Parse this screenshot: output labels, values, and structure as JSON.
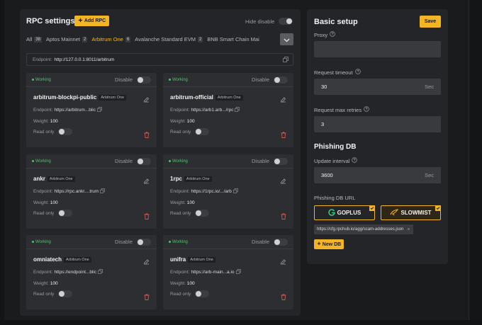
{
  "rpc": {
    "title": "RPC settings",
    "add_label": "Add RPC",
    "hide_disable_label": "Hide disable",
    "endpoint_label": "Endpoint:",
    "endpoint_value": "http://127.0.0.1:8011/arbitrum",
    "tabs": [
      {
        "label": "All",
        "count": "38"
      },
      {
        "label": "Aptos Mainnet",
        "count": "2"
      },
      {
        "label": "Arbitrum One",
        "count": "6"
      },
      {
        "label": "Avalanche Standard EVM",
        "count": "2"
      },
      {
        "label": "BNB Smart Chain Mai",
        "count": ""
      }
    ],
    "active_tab": "Arbitrum One",
    "status_label": "Working",
    "disable_label": "Disable",
    "endpoint_field_label": "Endpoint:",
    "weight_label": "Weight:",
    "readonly_label": "Read only",
    "cards": [
      {
        "name": "arbitrum-blockpi-public",
        "chain": "Arbitrum One",
        "endpoint": "https://arbitrum...blic",
        "weight": "100"
      },
      {
        "name": "arbitrum-official",
        "chain": "Arbitrum One",
        "endpoint": "https://arb1.arb.../rpc",
        "weight": "100"
      },
      {
        "name": "ankr",
        "chain": "Arbitrum One",
        "endpoint": "https://rpc.ankr....trum",
        "weight": "100"
      },
      {
        "name": "1rpc",
        "chain": "Arbitrum One",
        "endpoint": "https://1rpc.io/.../arb",
        "weight": "100"
      },
      {
        "name": "omniatech",
        "chain": "Arbitrum One",
        "endpoint": "https://endpoint...blic",
        "weight": "100"
      },
      {
        "name": "unifra",
        "chain": "Arbitrum One",
        "endpoint": "https://arb-main...a.io",
        "weight": "100"
      }
    ]
  },
  "basic": {
    "title": "Basic setup",
    "save_label": "Save",
    "proxy_label": "Proxy",
    "proxy_value": "",
    "timeout_label": "Request timeout",
    "timeout_value": "30",
    "timeout_unit": "Sec",
    "retries_label": "Request max retries",
    "retries_value": "3",
    "phishing_title": "Phishing DB",
    "interval_label": "Update interval",
    "interval_value": "3600",
    "interval_unit": "Sec",
    "url_label": "Phishing DB URL",
    "providers": [
      {
        "label": "GOPLUS",
        "selected": true
      },
      {
        "label": "SLOWMIST",
        "selected": true
      }
    ],
    "url_chip": "https://cfg.rpchub.io/agg/scam-addresses.json",
    "new_db_label": "New DB"
  },
  "colors": {
    "accent": "#f3b526",
    "working": "#4ec26c",
    "danger": "#d9534f",
    "background": "#1a1b1d",
    "panel": "#242528",
    "card": "#2d2e32"
  },
  "icons": [
    "plus-icon",
    "chevron-down-icon",
    "copy-icon",
    "edit-icon",
    "trash-icon",
    "help-icon",
    "check-icon",
    "close-icon",
    "goplus-logo-icon",
    "slowmist-logo-icon"
  ]
}
